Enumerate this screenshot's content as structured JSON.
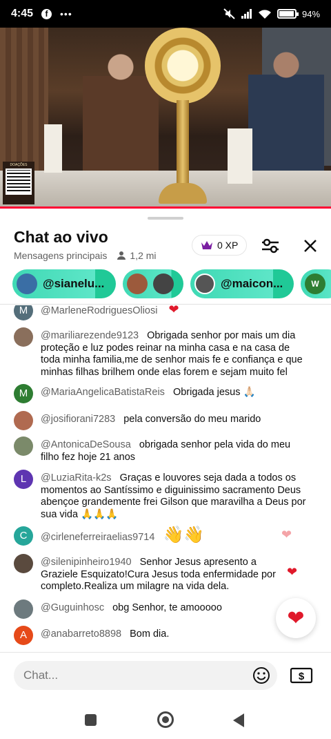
{
  "status_bar": {
    "time": "4:45",
    "battery": "94",
    "battery_level": 0.94
  },
  "video": {
    "donation_label": "DOAÇÕES"
  },
  "chat": {
    "title": "Chat ao vivo",
    "mode": "Mensagens principais",
    "viewers": "1,2 mi",
    "xp": "0 XP",
    "chips": [
      {
        "label": "@sianelu..."
      },
      {
        "label": ""
      },
      {
        "label": "@maicon..."
      },
      {
        "label": ""
      }
    ],
    "chip_avatar_letter": "W",
    "messages": [
      {
        "letter": "M",
        "color": "#3c6e47",
        "author": "@MarleneRodriguesOliosi",
        "text": ""
      },
      {
        "letter": "",
        "color": "#8a6f5c",
        "author": "@mariliarezende9123",
        "text": "Obrigada senhor por mais um dia proteção e luz podes reinar na minha casa e na casa de toda minha familia,me de senhor mais fe e confiança e que minhas filhas brilhem onde elas forem e sejam muito fel"
      },
      {
        "letter": "M",
        "color": "#2e7d32",
        "author": "@MariaAngelicaBatistaReis",
        "text": "Obrigada jesus 🙏🏻"
      },
      {
        "letter": "",
        "color": "#b06a50",
        "author": "@josifiorani7283",
        "text": "pela conversão do meu marido"
      },
      {
        "letter": "",
        "color": "#7b8a6a",
        "author": "@AntonicaDeSousa",
        "text": "obrigada senhor pela vida do meu filho fez hoje 21 anos"
      },
      {
        "letter": "L",
        "color": "#5e35b1",
        "author": "@LuziaRita-k2s",
        "text": "Graças e louvores seja dada a todos os momentos ao Santíssimo e diguinissimo sacramento Deus abençoe grandemente frei Gilson que maravilha a Deus por sua vida 🙏🙏🙏"
      },
      {
        "letter": "C",
        "color": "#26a69a",
        "author": "@cirleneferreiraelias9714",
        "text": "👋👋"
      },
      {
        "letter": "",
        "color": "#5a4a3e",
        "author": "@silenipinheiro1940",
        "text": "Senhor Jesus apresento a Graziele Esquizato!Cura Jesus toda enfermidade por completo.Realiza um milagre na vida dela."
      },
      {
        "letter": "",
        "color": "#6d7a7e",
        "author": "@Guguinhosc",
        "text": "obg Senhor, te amooooo"
      },
      {
        "letter": "A",
        "color": "#e64a19",
        "author": "@anabarreto8898",
        "text": "Bom dia."
      }
    ],
    "input_placeholder": "Chat..."
  },
  "icons": {
    "facebook": "facebook-icon",
    "crown": "crown-icon",
    "filter": "filter-sliders-icon",
    "close": "close-icon",
    "heart": "heart-icon",
    "emoji": "emoji-icon",
    "super_chat": "dollar-bill-icon",
    "person": "person-icon"
  },
  "colors": {
    "accent_red": "#e0192b",
    "chip_teal": "#3fd9b4",
    "crown_purple": "#7b1fa2"
  }
}
